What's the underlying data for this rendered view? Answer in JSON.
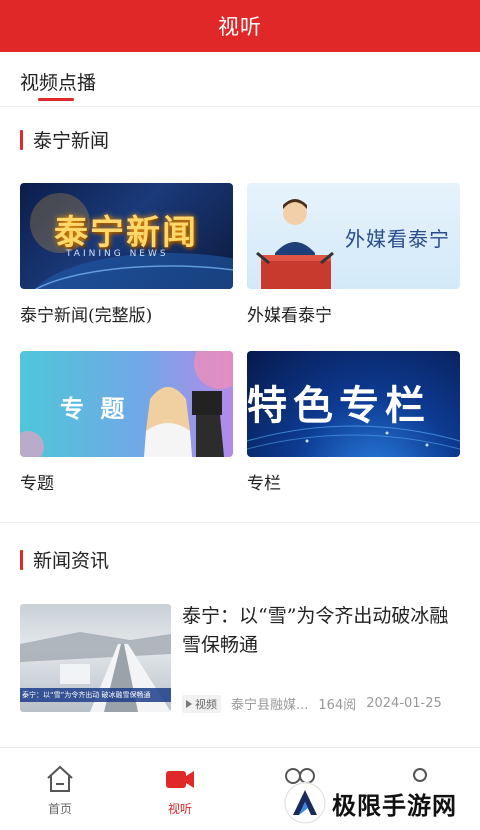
{
  "header": {
    "title": "视听"
  },
  "subtabs": {
    "active": "视频点播"
  },
  "sections": {
    "video": {
      "title": "泰宁新闻"
    },
    "news": {
      "title": "新闻资讯"
    }
  },
  "cards": [
    {
      "label": "泰宁新闻(完整版)",
      "thumb_text": "泰宁新闻",
      "thumb_sub": "TAINING NEWS"
    },
    {
      "label": "外媒看泰宁",
      "thumb_text": "外媒看泰宁"
    },
    {
      "label": "专题",
      "thumb_text": "专  题"
    },
    {
      "label": "专栏",
      "thumb_text": "特色专栏"
    }
  ],
  "news_item": {
    "title": "泰宁：以“雪”为令齐出动破冰融雪保畅通",
    "thumb_caption": "泰宁：以“雪”为令齐出动 破冰融雪保畅通",
    "tag": "视频",
    "source": "泰宁县融媒...",
    "reads": "164阅",
    "date": "2024-01-25"
  },
  "bottom_nav": [
    {
      "label": "首页",
      "icon": "home-icon"
    },
    {
      "label": "视听",
      "icon": "video-camera-icon",
      "active": true
    },
    {
      "label": "",
      "icon": "circles-icon"
    },
    {
      "label": "",
      "icon": "user-icon"
    }
  ],
  "watermark": {
    "text": "极限手游网"
  },
  "colors": {
    "accent": "#e02828"
  }
}
